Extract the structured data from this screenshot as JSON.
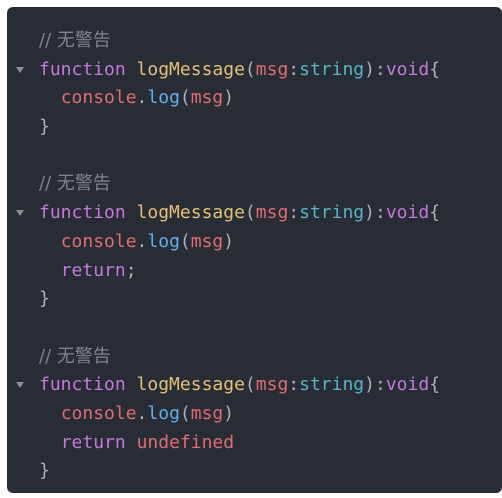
{
  "blocks": [
    {
      "comment": "// 无警告",
      "keyword": "function",
      "name": "logMessage",
      "param": "msg",
      "param_type": "string",
      "return_type": "void",
      "body_object": "console",
      "body_method": "log",
      "body_arg": "msg"
    },
    {
      "comment": "// 无警告",
      "keyword": "function",
      "name": "logMessage",
      "param": "msg",
      "param_type": "string",
      "return_type": "void",
      "body_object": "console",
      "body_method": "log",
      "body_arg": "msg",
      "return_keyword": "return"
    },
    {
      "comment": "// 无警告",
      "keyword": "function",
      "name": "logMessage",
      "param": "msg",
      "param_type": "string",
      "return_type": "void",
      "body_object": "console",
      "body_method": "log",
      "body_arg": "msg",
      "return_keyword": "return",
      "return_value": "undefined"
    }
  ],
  "colors": {
    "background": "#282c34",
    "comment": "#7f848e",
    "keyword": "#c678dd",
    "function_name": "#e5c07b",
    "parameter": "#e06c75",
    "type": "#56b6c2",
    "method": "#61afef"
  }
}
